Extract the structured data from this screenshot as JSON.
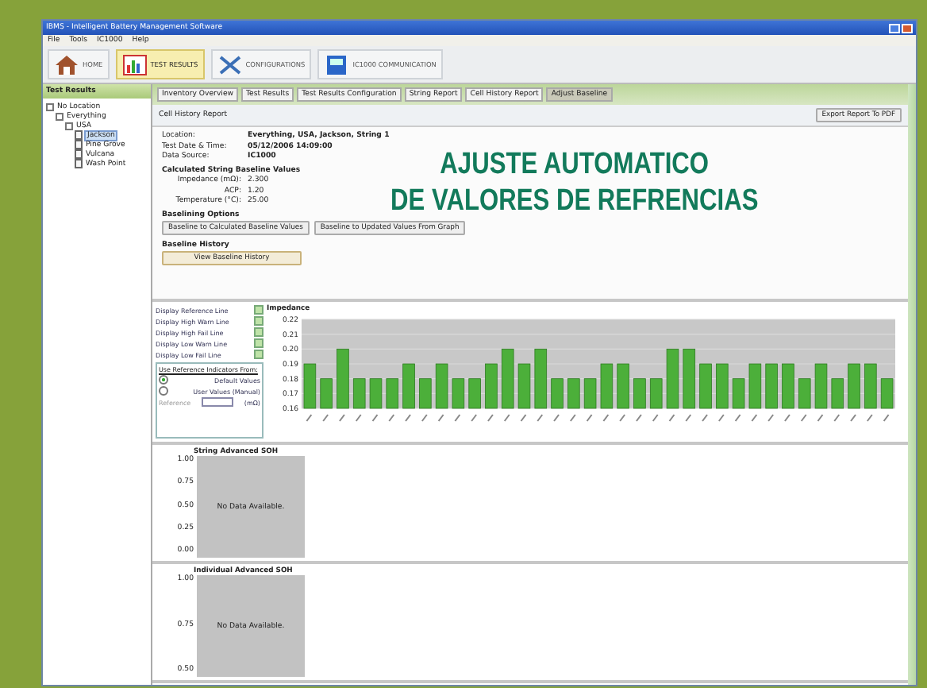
{
  "window": {
    "title": "IBMS - Intelligent Battery Management Software"
  },
  "menu": [
    "File",
    "Tools",
    "IC1000",
    "Help"
  ],
  "toolbar": [
    {
      "label": "HOME",
      "kind": "home",
      "selected": false
    },
    {
      "label": "TEST RESULTS",
      "kind": "results",
      "selected": true
    },
    {
      "label": "CONFIGURATIONS",
      "kind": "config",
      "selected": false
    },
    {
      "label": "IC1000 COMMUNICATION",
      "kind": "comm",
      "selected": false
    }
  ],
  "sidebar": {
    "title": "Test Results",
    "tree": [
      {
        "label": "No Location",
        "selected": false,
        "children": [
          {
            "label": "Everything",
            "selected": false,
            "children": [
              {
                "label": "USA",
                "selected": false,
                "children": [
                  {
                    "label": "Jackson",
                    "selected": true
                  },
                  {
                    "label": "Pine Grove",
                    "selected": false
                  },
                  {
                    "label": "Vulcana",
                    "selected": false
                  },
                  {
                    "label": "Wash Point",
                    "selected": false
                  }
                ]
              }
            ]
          }
        ]
      }
    ]
  },
  "tabs": [
    {
      "label": "Inventory Overview",
      "selected": false
    },
    {
      "label": "Test Results",
      "selected": false
    },
    {
      "label": "Test Results Configuration",
      "selected": false
    },
    {
      "label": "String Report",
      "selected": false
    },
    {
      "label": "Cell History Report",
      "selected": false
    },
    {
      "label": "Adjust Baseline",
      "selected": true
    }
  ],
  "report": {
    "title": "Cell History Report",
    "export_button": "Export Report To PDF",
    "info": [
      {
        "label": "Location:",
        "value": "Everything, USA, Jackson, String 1"
      },
      {
        "label": "Test Date & Time:",
        "value": "05/12/2006 14:09:00"
      },
      {
        "label": "Data Source:",
        "value": "IC1000"
      }
    ],
    "baseline_heading": "Calculated String Baseline Values",
    "baseline": [
      {
        "label": "Impedance (mΩ):",
        "value": "2.300"
      },
      {
        "label": "ACP:",
        "value": "1.20"
      },
      {
        "label": "Temperature (°C):",
        "value": "25.00"
      }
    ],
    "options_heading": "Baselining Options",
    "option_buttons": [
      "Baseline to Calculated Baseline Values",
      "Baseline to Updated Values From Graph"
    ],
    "history_heading": "Baseline History",
    "history_button": "View Baseline History"
  },
  "overlay": [
    "AJUSTE AUTOMATICO",
    "DE VALORES DE REFRENCIAS"
  ],
  "display_options": [
    {
      "label": "Display Reference Line",
      "checked": true
    },
    {
      "label": "Display High Warn Line",
      "checked": true
    },
    {
      "label": "Display High Fail Line",
      "checked": true
    },
    {
      "label": "Display Low Warn Line",
      "checked": true
    },
    {
      "label": "Display Low Fail Line",
      "checked": true
    }
  ],
  "indicators": {
    "title": "Use Reference Indicators From:",
    "radios": [
      {
        "label": "Default Values",
        "selected": true
      },
      {
        "label": "User Values (Manual)",
        "selected": false
      }
    ],
    "fields": [
      {
        "label": "Reference",
        "unit": "(mΩ)"
      }
    ]
  },
  "impedance_chart": {
    "chart_data": {
      "type": "bar",
      "title": "Impedance",
      "ylim": [
        0.16,
        0.22
      ],
      "yticks": [
        {
          "value": 0.16,
          "label": "0.16"
        },
        {
          "value": 0.17,
          "label": "0.17"
        },
        {
          "value": 0.18,
          "label": "0.18"
        },
        {
          "value": 0.19,
          "label": "0.19"
        },
        {
          "value": 0.2,
          "label": "0.20"
        },
        {
          "value": 0.21,
          "label": "0.21"
        },
        {
          "value": 0.22,
          "label": "0.22"
        }
      ],
      "grid": true,
      "series": [
        {
          "color": "#4caf3a",
          "values": [
            0.19,
            0.18,
            0.2,
            0.18,
            0.18,
            0.18,
            0.19,
            0.18,
            0.19,
            0.18,
            0.18,
            0.19,
            0.2,
            0.19,
            0.2,
            0.18,
            0.18,
            0.18,
            0.19,
            0.19,
            0.18,
            0.18,
            0.2,
            0.2,
            0.19,
            0.19,
            0.18,
            0.19,
            0.19,
            0.19,
            0.18,
            0.19,
            0.18,
            0.19,
            0.19,
            0.18
          ]
        }
      ]
    }
  },
  "soh_charts": [
    {
      "title": "String Advanced SOH",
      "message": "No Data Available.",
      "yticks": [
        "1.00",
        "0.75",
        "0.50",
        "0.25",
        "0.00"
      ]
    },
    {
      "title": "Individual Advanced SOH",
      "message": "No Data Available.",
      "yticks": [
        "1.00",
        "0.75",
        "0.50"
      ]
    }
  ]
}
